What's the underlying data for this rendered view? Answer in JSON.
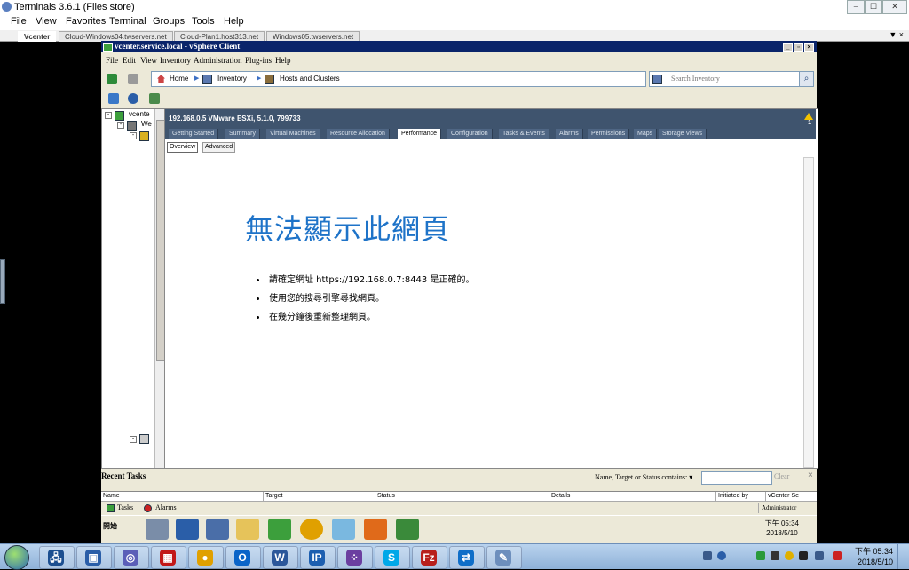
{
  "outer_window": {
    "title": "Terminals 3.6.1 (Files store)",
    "menu": [
      "File",
      "View",
      "Favorites",
      "Terminal",
      "Groups",
      "Tools",
      "Help"
    ],
    "tabs": [
      {
        "label": "Vcenter",
        "active": true
      },
      {
        "label": "Cloud-Windows04.twservers.net"
      },
      {
        "label": "Cloud-Plan1.host313.net"
      },
      {
        "label": "Windows05.twservers.net"
      }
    ],
    "tabs_close": "▼ ×",
    "buttons": {
      "minimize": "⎯",
      "maximize": "☐",
      "close": "✕"
    }
  },
  "vsphere": {
    "title": "vcenter.service.local - vSphere Client",
    "menu": [
      "File",
      "Edit",
      "View",
      "Inventory",
      "Administration",
      "Plug-ins",
      "Help"
    ],
    "breadcrumb": {
      "home": "Home",
      "inventory": "Inventory",
      "hosts_clusters": "Hosts and Clusters"
    },
    "search": {
      "placeholder": "Search Inventory",
      "icon": "search-icon"
    },
    "tree": {
      "root": "vcente",
      "child": "We"
    },
    "host_header": "192.168.0.5 VMware ESXi, 5.1.0, 799733",
    "warning_count": "1",
    "tabs": [
      "Getting Started",
      "Summary",
      "Virtual Machines",
      "Resource Allocation",
      "Performance",
      "Configuration",
      "Tasks & Events",
      "Alarms",
      "Permissions",
      "Maps",
      "Storage Views"
    ],
    "active_tab": "Performance",
    "subtabs": [
      "Overview",
      "Advanced"
    ],
    "error": {
      "title": "無法顯示此網頁",
      "items": [
        "請確定網址 https://192.168.0.7:8443 是正確的。",
        "使用您的搜尋引擎尋找網頁。",
        "在幾分鐘後重新整理網頁。"
      ]
    },
    "recent_tasks": {
      "title": "Recent Tasks",
      "filter_label": "Name, Target or Status contains: ▾",
      "filter_value": "",
      "clear": "Clear",
      "columns": [
        "Name",
        "Target",
        "Status",
        "Details",
        "Initiated by",
        "vCenter Se"
      ],
      "tab_tasks": "Tasks",
      "tab_alarms": "Alarms",
      "user": "Administrator"
    },
    "inner_taskbar": {
      "start": "開始",
      "clock_time": "下午 05:34",
      "clock_date": "2018/5/10"
    }
  },
  "taskbar": {
    "clock_time": "下午 05:34",
    "clock_date": "2018/5/10",
    "apps": [
      "remote-desktop-icon",
      "remote-desktop-icon",
      "globe-icon",
      "red-app-icon",
      "chrome-icon",
      "outlook-icon",
      "word-icon",
      "ip-icon",
      "dots-app-icon",
      "skype-icon",
      "filezilla-icon",
      "teamviewer-icon",
      "notepad-icon"
    ],
    "app_glyphs": [
      "🖧",
      "▣",
      "◎",
      "▦",
      "●",
      "O",
      "W",
      "IP",
      "⁘",
      "S",
      "Fz",
      "⇄",
      "✎"
    ],
    "app_colors": [
      "#1c4f90",
      "#2a5ea8",
      "#5b5fb8",
      "#c21818",
      "#e0a000",
      "#0a64c8",
      "#2b579a",
      "#1d5fb0",
      "#6b3fa0",
      "#00a8e8",
      "#b8201c",
      "#0e6ec8",
      "#6d8fbd"
    ]
  }
}
